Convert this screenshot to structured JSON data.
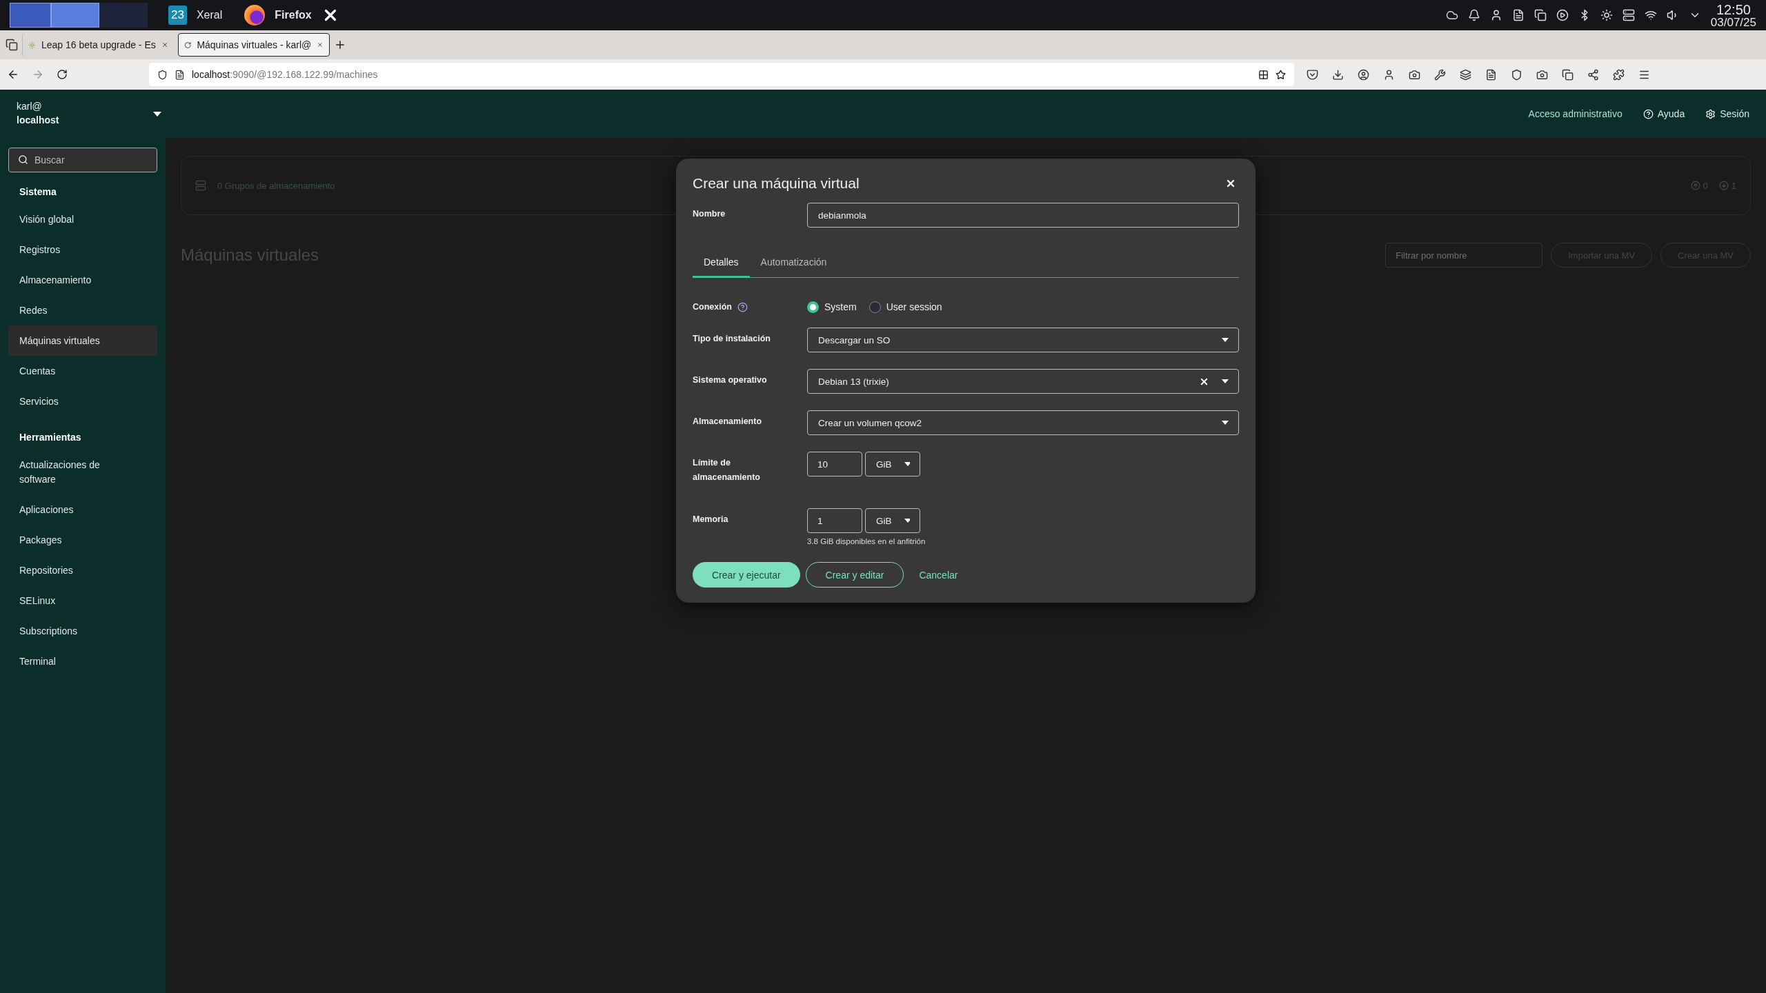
{
  "desktop_panel": {
    "badge": "23",
    "app_label": "Xeral",
    "active_window": "Firefox",
    "clock_time": "12:50",
    "clock_date": "03/07/25"
  },
  "browser": {
    "tabs": [
      {
        "title": "Leap 16 beta upgrade - Es",
        "selected": false
      },
      {
        "title": "Máquinas virtuales - karl@",
        "selected": true
      }
    ],
    "url_host": "localhost",
    "url_rest": ":9090/@192.168.122.99/machines"
  },
  "header": {
    "user": "karl@",
    "host": "localhost",
    "admin_access": "Acceso administrativo",
    "help": "Ayuda",
    "session": "Sesión"
  },
  "sidebar": {
    "search_placeholder": "Buscar",
    "sections": [
      {
        "title": "Sistema",
        "items": [
          {
            "label": "Visión global",
            "selected": false
          },
          {
            "label": "Registros",
            "selected": false
          },
          {
            "label": "Almacenamiento",
            "selected": false
          },
          {
            "label": "Redes",
            "selected": false
          },
          {
            "label": "Máquinas virtuales",
            "selected": true
          },
          {
            "label": "Cuentas",
            "selected": false
          },
          {
            "label": "Servicios",
            "selected": false
          }
        ]
      },
      {
        "title": "Herramientas",
        "items": [
          {
            "label": "Actualizaciones de software",
            "selected": false
          },
          {
            "label": "Aplicaciones",
            "selected": false
          },
          {
            "label": "Packages",
            "selected": false
          },
          {
            "label": "Repositories",
            "selected": false
          },
          {
            "label": "SELinux",
            "selected": false
          },
          {
            "label": "Subscriptions",
            "selected": false
          },
          {
            "label": "Terminal",
            "selected": false
          }
        ]
      }
    ]
  },
  "page": {
    "storage_pools": "0 Grupos de almacenamiento",
    "counts": [
      "0",
      "1"
    ],
    "title": "Máquinas virtuales",
    "filter_placeholder": "Filtrar por nombre",
    "buttons": [
      "Importar una MV",
      "Crear una MV"
    ]
  },
  "dialog": {
    "title": "Crear una máquina virtual",
    "name_label": "Nombre",
    "name_value": "debianmola",
    "tabs": [
      {
        "label": "Detalles",
        "selected": true
      },
      {
        "label": "Automatización",
        "selected": false
      }
    ],
    "rows": [
      {
        "kind": "radio",
        "label": "Conexión",
        "options": [
          {
            "label": "System",
            "selected": true
          },
          {
            "label": "User session",
            "selected": false
          }
        ]
      },
      {
        "kind": "select",
        "label": "Tipo de instalación",
        "value": "Descargar un SO",
        "clearable": false
      },
      {
        "kind": "select",
        "label": "Sistema operativo",
        "value": "Debian 13 (trixie)",
        "clearable": true
      },
      {
        "kind": "select",
        "label": "Almacenamiento",
        "value": "Crear un volumen qcow2",
        "clearable": false
      },
      {
        "kind": "size",
        "label": "Límite de almacenamiento",
        "value": "10",
        "unit": "GiB"
      },
      {
        "kind": "size",
        "label": "Memoria",
        "value": "1",
        "unit": "GiB",
        "hint": "3.8 GiB disponibles en el anfitrión"
      }
    ],
    "buttons": [
      {
        "kind": "primary",
        "label": "Crear y ejecutar"
      },
      {
        "kind": "secondary",
        "label": "Crear y editar"
      },
      {
        "kind": "link",
        "label": "Cancelar"
      }
    ]
  }
}
